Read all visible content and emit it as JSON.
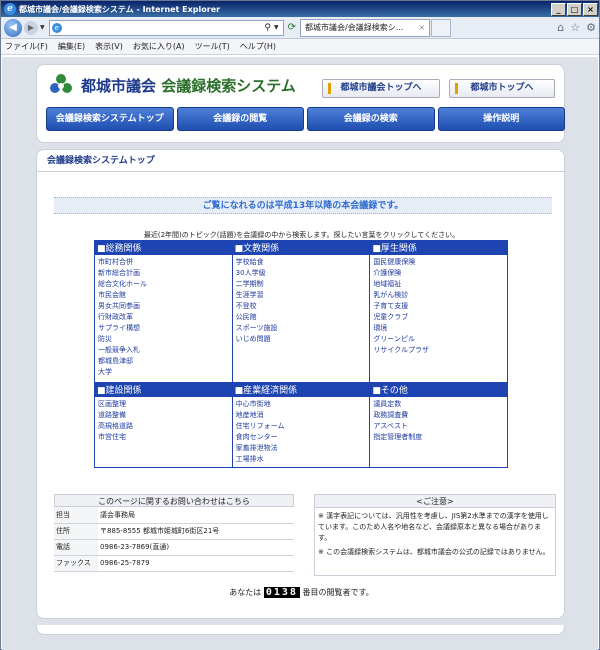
{
  "window": {
    "title": "都城市議会/会議録検索システム - Internet Explorer",
    "controls": [
      "_",
      "□",
      "×"
    ]
  },
  "addressbar": {
    "tab_title": "都城市議会/会議録検索シ...",
    "tab_close": "×"
  },
  "menubar": {
    "items": [
      "ファイル(F)",
      "編集(E)",
      "表示(V)",
      "お気に入り(A)",
      "ツール(T)",
      "ヘルプ(H)"
    ]
  },
  "header": {
    "title_main": "都城市議会",
    "title_sub": "会議録検索システム",
    "link_council_top": "都城市議会トップへ",
    "link_city_top": "都城市トップへ"
  },
  "mainnav": {
    "items": [
      "会議録検索システムトップ",
      "会議録の閲覧",
      "会議録の検索",
      "操作説明"
    ]
  },
  "content": {
    "section_title": "会議録検索システムトップ",
    "notice": "ご覧になれるのは平成13年以降の本会議録です。",
    "instruction": "最近(2年間)のトピック(話題)を会議録の中から検索します。探したい言葉をクリックしてください。"
  },
  "topics": {
    "row1": [
      {
        "header": "■総務関係",
        "items": [
          "市町村合併",
          "新市総合計画",
          "総合文化ホール",
          "市民会館",
          "男女共同参画",
          "行財政改革",
          "サプライ構想",
          "防災",
          "一般競争入札",
          "都城島津邸",
          "大学"
        ]
      },
      {
        "header": "■文教関係",
        "items": [
          "学校給食",
          "30人学級",
          "二学期制",
          "生涯学習",
          "不登校",
          "公民館",
          "スポーツ施設",
          "いじめ問題"
        ]
      },
      {
        "header": "■厚生関係",
        "items": [
          "国民健康保険",
          "介護保険",
          "地域福祉",
          "乳がん検診",
          "子育て支援",
          "児童クラブ",
          "環境",
          "グリーンピル",
          "リサイクルプラザ"
        ]
      }
    ],
    "row2": [
      {
        "header": "■建設関係",
        "items": [
          "区画整理",
          "道路整備",
          "高規格道路",
          "市営住宅"
        ]
      },
      {
        "header": "■産業経済関係",
        "items": [
          "中心市街地",
          "地産地消",
          "住宅リフォーム",
          "食肉センター",
          "家畜排泄物法",
          "工場排水"
        ]
      },
      {
        "header": "■その他",
        "items": [
          "議員定数",
          "政務調査費",
          "アスベスト",
          "指定管理者制度"
        ]
      }
    ]
  },
  "contact": {
    "caption": "このページに関するお問い合わせはこちら",
    "rows": [
      {
        "key": "担当",
        "value": "議会事務局"
      },
      {
        "key": "住所",
        "value": "〒885-8555 都城市姫城町6街区21号"
      },
      {
        "key": "電話",
        "value": "0986-23-7869(直通)"
      },
      {
        "key": "ファックス",
        "value": "0986-25-7879"
      }
    ]
  },
  "caution": {
    "title": "<ご注意>",
    "p1": "※ 漢字表記については、汎用性を考慮し、JIS第2水準までの漢字を使用しています。このため人名や地名など、会議録原本と異なる場合があります。",
    "p2": "※ この会議録検索システムは、都城市議会の公式の記録ではありません。"
  },
  "counter": {
    "prefix": "あなたは",
    "digits": "0138",
    "suffix": "番目の閲覧者です。"
  }
}
